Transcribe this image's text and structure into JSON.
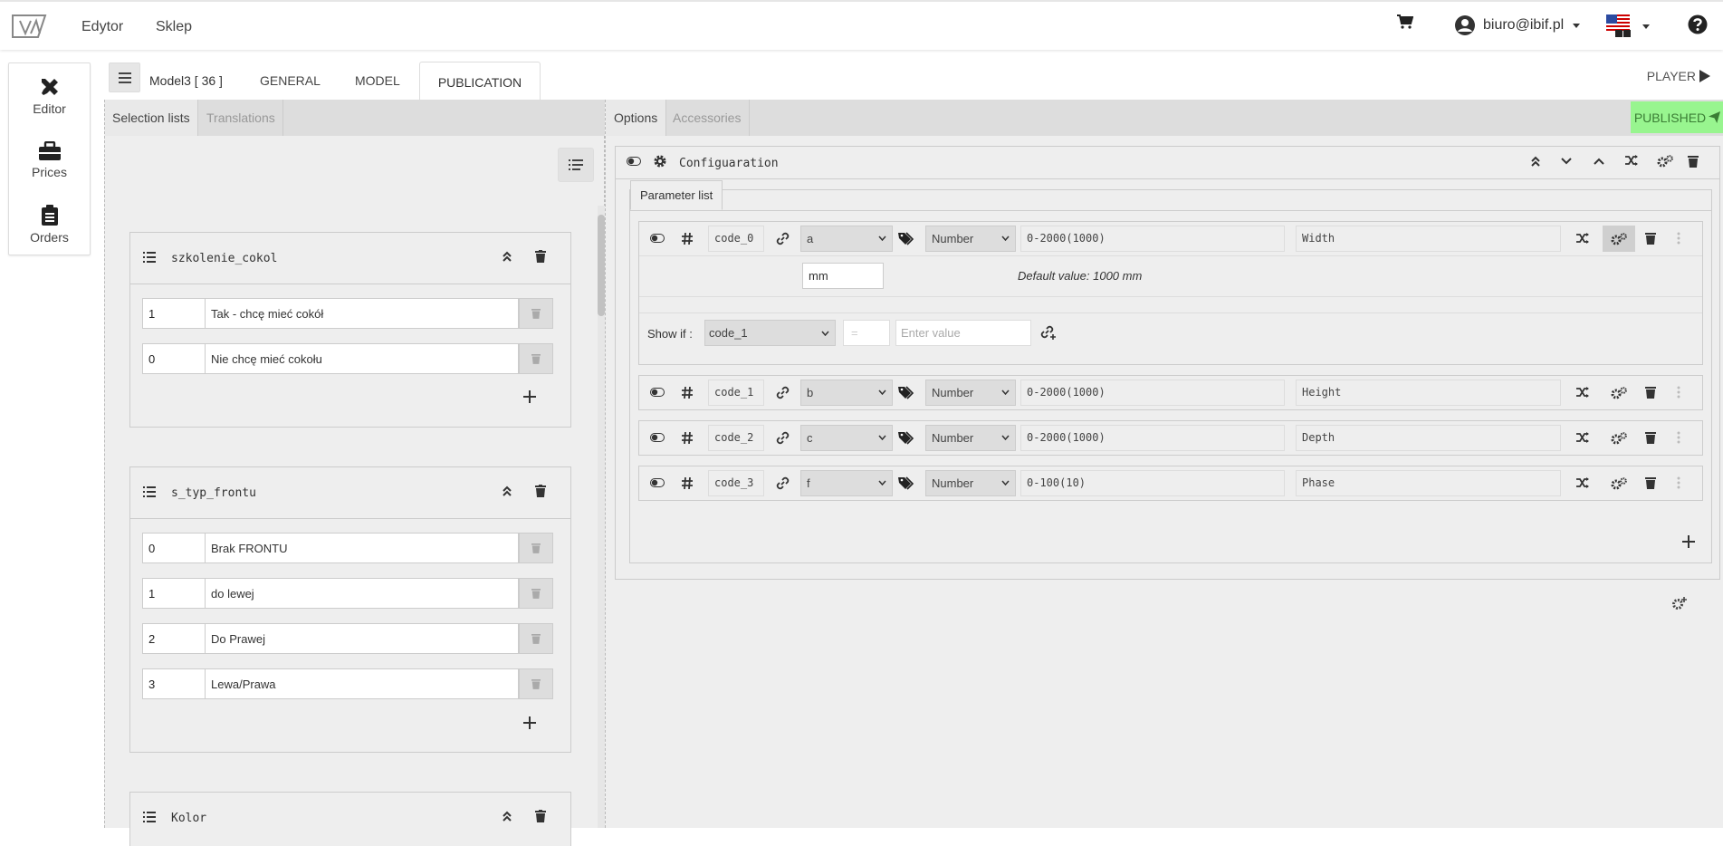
{
  "navbar": {
    "links": [
      "Edytor",
      "Sklep"
    ],
    "user_email": "biuro@ibif.pl"
  },
  "sidebar": {
    "items": [
      {
        "label": "Editor",
        "icon": "tools-icon"
      },
      {
        "label": "Prices",
        "icon": "toolbox-icon"
      },
      {
        "label": "Orders",
        "icon": "clipboard-icon"
      }
    ]
  },
  "model": {
    "name": "Model3 [ 36 ]",
    "tabs": [
      "GENERAL",
      "MODEL",
      "PUBLICATION"
    ],
    "active_tab": "PUBLICATION",
    "player_label": "PLAYER"
  },
  "left_panel": {
    "tabs": [
      "Selection lists",
      "Translations"
    ],
    "lists": [
      {
        "title": "szkolenie_cokol",
        "rows": [
          {
            "code": "1",
            "label": "Tak - chcę mieć cokół"
          },
          {
            "code": "0",
            "label": "Nie chcę mieć cokołu"
          }
        ]
      },
      {
        "title": "s_typ_frontu",
        "rows": [
          {
            "code": "0",
            "label": "Brak FRONTU"
          },
          {
            "code": "1",
            "label": "do lewej"
          },
          {
            "code": "2",
            "label": "Do Prawej"
          },
          {
            "code": "3",
            "label": "Lewa/Prawa"
          }
        ]
      },
      {
        "title": "Kolor",
        "rows": []
      }
    ]
  },
  "right_panel": {
    "tabs": [
      "Options",
      "Accessories"
    ],
    "published_label": "PUBLISHED",
    "config_title": "Configuaration",
    "param_tab": "Parameter list",
    "params": [
      {
        "code": "code_0",
        "var": "a",
        "type": "Number",
        "range": "0-2000(1000)",
        "name": "Width"
      },
      {
        "code": "code_1",
        "var": "b",
        "type": "Number",
        "range": "0-2000(1000)",
        "name": "Height"
      },
      {
        "code": "code_2",
        "var": "c",
        "type": "Number",
        "range": "0-2000(1000)",
        "name": "Depth"
      },
      {
        "code": "code_3",
        "var": "f",
        "type": "Number",
        "range": "0-100(10)",
        "name": "Phase"
      }
    ],
    "expanded": {
      "unit": "mm",
      "default_text": "Default value: 1000 mm",
      "showif_label": "Show if :",
      "showif_select": "code_1",
      "operator": "=",
      "value_placeholder": "Enter value"
    }
  },
  "colors": {
    "published_bg": "#98f58f",
    "panel_bg": "#eeeeee",
    "tab_bar_bg": "#dddddd"
  }
}
